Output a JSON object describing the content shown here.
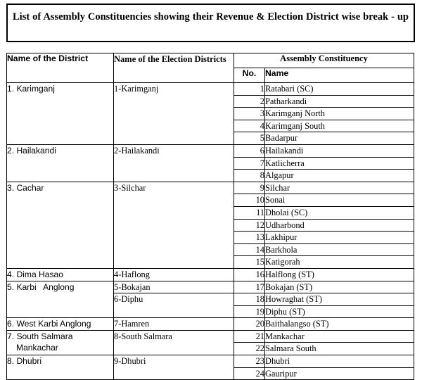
{
  "document": {
    "title": "List of Assembly Constituencies showing their Revenue & Election District wise break - up"
  },
  "table": {
    "headers": {
      "district": "Name of the District",
      "election_district": "Name of the Election Districts",
      "assembly_constituency": "Assembly Constituency",
      "ac_no": "No.",
      "ac_name": "Name"
    },
    "districts": [
      {
        "name": "1. Karimganj",
        "name_spaced": "1. Karimganj",
        "rowspan": 5,
        "election_districts": [
          {
            "name": "1-Karimganj",
            "rowspan": 5
          }
        ],
        "constituencies": [
          {
            "no": "1",
            "name": "Ratabari (SC)"
          },
          {
            "no": "2",
            "name": "Patharkandi"
          },
          {
            "no": "3",
            "name": "Karimganj North"
          },
          {
            "no": "4",
            "name": "Karimganj South"
          },
          {
            "no": "5",
            "name": "Badarpur"
          }
        ]
      },
      {
        "name": "2. Hailakandi",
        "name_spaced": "2. Hailakandi",
        "rowspan": 3,
        "election_districts": [
          {
            "name": "2-Hailakandi",
            "rowspan": 3
          }
        ],
        "constituencies": [
          {
            "no": "6",
            "name": "Hailakandi"
          },
          {
            "no": "7",
            "name": "Katlicherra"
          },
          {
            "no": "8",
            "name": "Algapur"
          }
        ]
      },
      {
        "name": "3. Cachar",
        "name_spaced": "3. Cachar",
        "rowspan": 7,
        "election_districts": [
          {
            "name": "3-Silchar",
            "rowspan": 7
          }
        ],
        "constituencies": [
          {
            "no": "9",
            "name": "Silchar"
          },
          {
            "no": "10",
            "name": "Sonai"
          },
          {
            "no": "11",
            "name": "Dholai (SC)"
          },
          {
            "no": "12",
            "name": "Udharbond"
          },
          {
            "no": "13",
            "name": "Lakhipur"
          },
          {
            "no": "14",
            "name": "Barkhola"
          },
          {
            "no": "15",
            "name": "Katigorah"
          }
        ]
      },
      {
        "name": "4. Dima Hasao",
        "name_spaced": "4. Dima Hasao",
        "rowspan": 1,
        "election_districts": [
          {
            "name": "4-Haflong",
            "rowspan": 1
          }
        ],
        "constituencies": [
          {
            "no": "16",
            "name": "Halflong (ST)"
          }
        ]
      },
      {
        "name": "5. Karbi Anglong",
        "name_spaced": "5. Karbi   Anglong",
        "rowspan": 3,
        "election_districts": [
          {
            "name": "5-Bokajan",
            "rowspan": 1
          },
          {
            "name": "6-Diphu",
            "rowspan": 2
          }
        ],
        "constituencies": [
          {
            "no": "17",
            "name": "Bokajan (ST)"
          },
          {
            "no": "18",
            "name": "Howraghat (ST)"
          },
          {
            "no": "19",
            "name": "Diphu (ST)"
          }
        ]
      },
      {
        "name": "6. West Karbi Anglong",
        "name_spaced": "6. West Karbi Anglong",
        "rowspan": 1,
        "election_districts": [
          {
            "name": "7-Hamren",
            "rowspan": 1
          }
        ],
        "constituencies": [
          {
            "no": "20",
            "name": "Baithalangso (ST)"
          }
        ]
      },
      {
        "name": "7. South Salmara Mankachar",
        "name_line1": "7. South Salmara",
        "name_line2": "Mankachar",
        "rowspan": 2,
        "election_districts": [
          {
            "name": "8-South Salmara",
            "rowspan": 2
          }
        ],
        "constituencies": [
          {
            "no": "21",
            "name": "Mankachar"
          },
          {
            "no": "22",
            "name": "Salmara South"
          }
        ]
      },
      {
        "name": "8. Dhubri",
        "name_spaced": "8. Dhubri",
        "rowspan": 2,
        "election_districts": [
          {
            "name": "9-Dhubri",
            "rowspan": 2
          }
        ],
        "constituencies": [
          {
            "no": "23",
            "name": "Dhubri"
          },
          {
            "no": "24",
            "name": "Gauripur"
          }
        ]
      }
    ]
  }
}
